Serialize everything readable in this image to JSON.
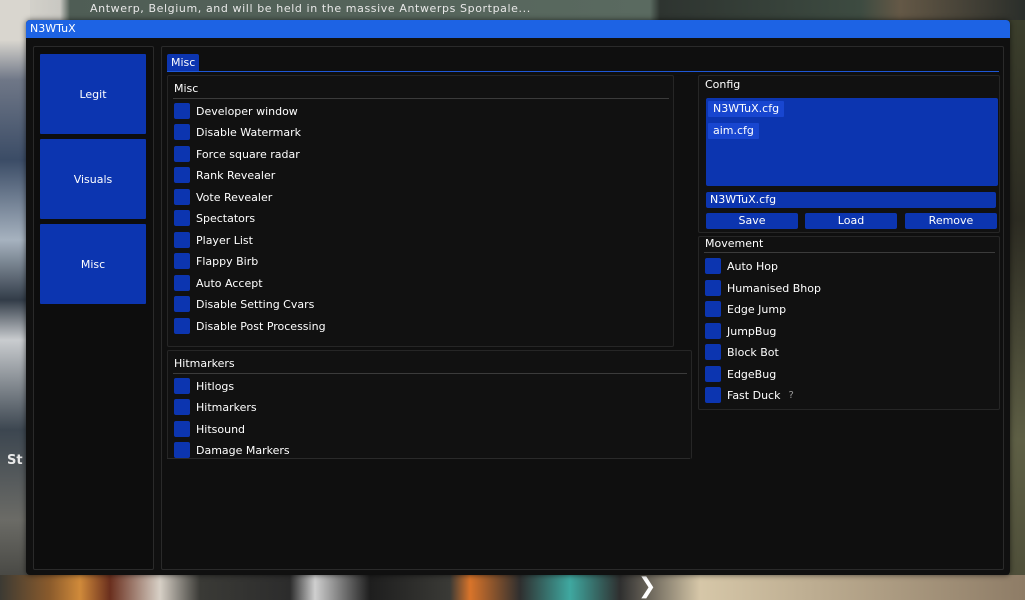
{
  "background": {
    "top_text": "Antwerp, Belgium, and will be held in the massive Antwerps Sportpale...",
    "left_label": "St"
  },
  "window": {
    "title": "N3WTuX"
  },
  "sidebar": {
    "items": [
      {
        "label": "Legit"
      },
      {
        "label": "Visuals"
      },
      {
        "label": "Misc"
      }
    ]
  },
  "main": {
    "tab_label": "Misc",
    "misc_group": {
      "title": "Misc",
      "items": [
        {
          "label": "Developer window"
        },
        {
          "label": "Disable Watermark"
        },
        {
          "label": "Force square radar"
        },
        {
          "label": "Rank Revealer"
        },
        {
          "label": "Vote Revealer"
        },
        {
          "label": "Spectators"
        },
        {
          "label": "Player List"
        },
        {
          "label": "Flappy Birb"
        },
        {
          "label": "Auto Accept"
        },
        {
          "label": "Disable Setting Cvars"
        },
        {
          "label": "Disable Post Processing"
        }
      ]
    },
    "hitmarkers_group": {
      "title": "Hitmarkers",
      "items": [
        {
          "label": "Hitlogs"
        },
        {
          "label": "Hitmarkers"
        },
        {
          "label": "Hitsound"
        },
        {
          "label": "Damage Markers"
        }
      ]
    },
    "config_group": {
      "title": "Config",
      "configs": [
        {
          "name": "N3WTuX.cfg"
        },
        {
          "name": "aim.cfg"
        }
      ],
      "name_input_value": "N3WTuX.cfg",
      "save_label": "Save",
      "load_label": "Load",
      "remove_label": "Remove"
    },
    "movement_group": {
      "title": "Movement",
      "items": [
        {
          "label": "Auto Hop"
        },
        {
          "label": "Humanised Bhop"
        },
        {
          "label": "Edge Jump"
        },
        {
          "label": "JumpBug"
        },
        {
          "label": "Block Bot"
        },
        {
          "label": "EdgeBug"
        },
        {
          "label": "Fast Duck",
          "help": "?"
        }
      ]
    }
  },
  "colors": {
    "accent": "#0c35b0",
    "title_bar": "#1d63e4",
    "panel": "#101010"
  }
}
